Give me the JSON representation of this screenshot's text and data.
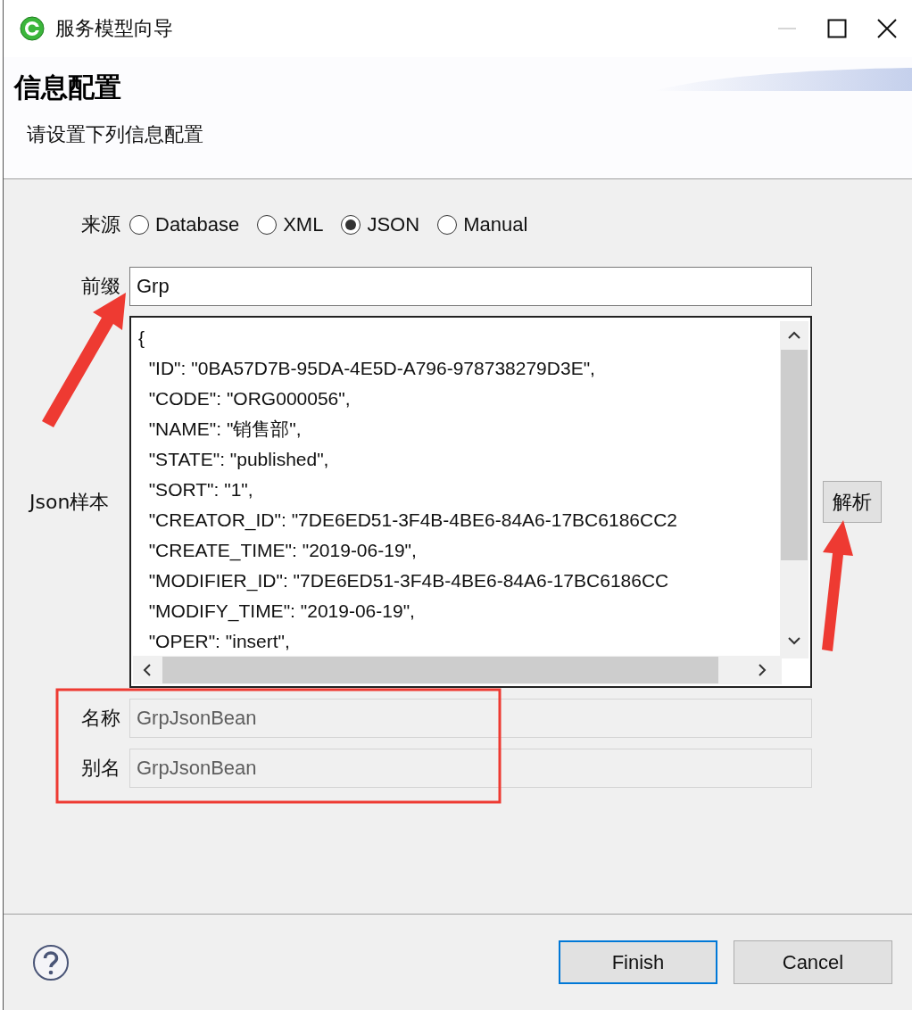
{
  "window": {
    "title": "服务模型向导",
    "minimize_disabled": true
  },
  "header": {
    "title": "信息配置",
    "subtitle": "请设置下列信息配置"
  },
  "source": {
    "label": "来源",
    "options": [
      {
        "label": "Database",
        "selected": false
      },
      {
        "label": "XML",
        "selected": false
      },
      {
        "label": "JSON",
        "selected": true
      },
      {
        "label": "Manual",
        "selected": false
      }
    ]
  },
  "prefix": {
    "label": "前缀",
    "value": "Grp",
    "disabled": false
  },
  "json_sample": {
    "label": "Json样本",
    "lines": [
      "{",
      "  \"ID\": \"0BA57D7B-95DA-4E5D-A796-978738279D3E\",",
      "  \"CODE\": \"ORG000056\",",
      "  \"NAME\": \"销售部\",",
      "  \"STATE\": \"published\",",
      "  \"SORT\": \"1\",",
      "  \"CREATOR_ID\": \"7DE6ED51-3F4B-4BE6-84A6-17BC6186CC2",
      "  \"CREATE_TIME\": \"2019-06-19\",",
      "  \"MODIFIER_ID\": \"7DE6ED51-3F4B-4BE6-84A6-17BC6186CC",
      "  \"MODIFY_TIME\": \"2019-06-19\",",
      "  \"OPER\": \"insert\","
    ]
  },
  "parse_button": {
    "label": "解析"
  },
  "name": {
    "label": "名称",
    "value": "GrpJsonBean",
    "disabled": true
  },
  "alias": {
    "label": "别名",
    "value": "GrpJsonBean",
    "disabled": true
  },
  "buttons": [
    {
      "label": "Finish",
      "default": true
    },
    {
      "label": "Cancel",
      "default": false
    }
  ]
}
